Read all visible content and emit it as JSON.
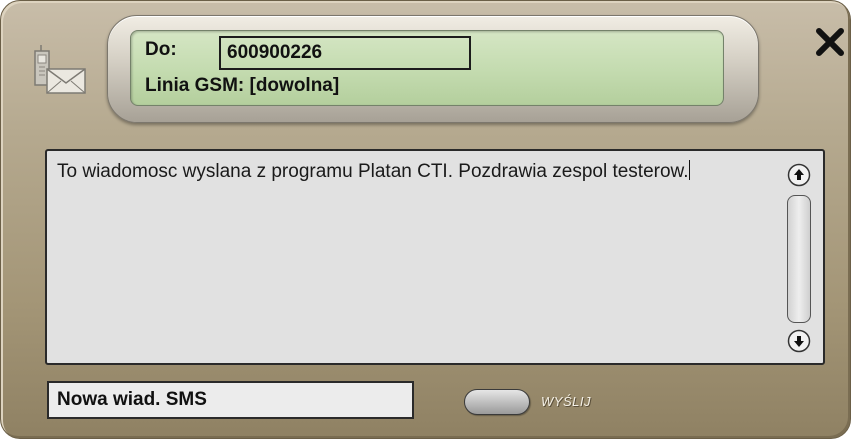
{
  "header": {
    "to_label": "Do:",
    "to_value": "600900226",
    "gsm_line": "Linia GSM: [dowolna]"
  },
  "message": {
    "text": "To wiadomosc wyslana z programu Platan CTI. Pozdrawia zespol testerow."
  },
  "footer": {
    "status_text": "Nowa wiad. SMS",
    "send_label": "WYŚLIJ"
  },
  "icons": {
    "app": "sms-phone-envelope-icon",
    "close": "close-icon",
    "scroll_up": "arrow-up-icon",
    "scroll_down": "arrow-down-icon"
  },
  "colors": {
    "frame": "#a89b7f",
    "lcd": "#c5dcb1",
    "message_bg": "#e1e1e1"
  }
}
